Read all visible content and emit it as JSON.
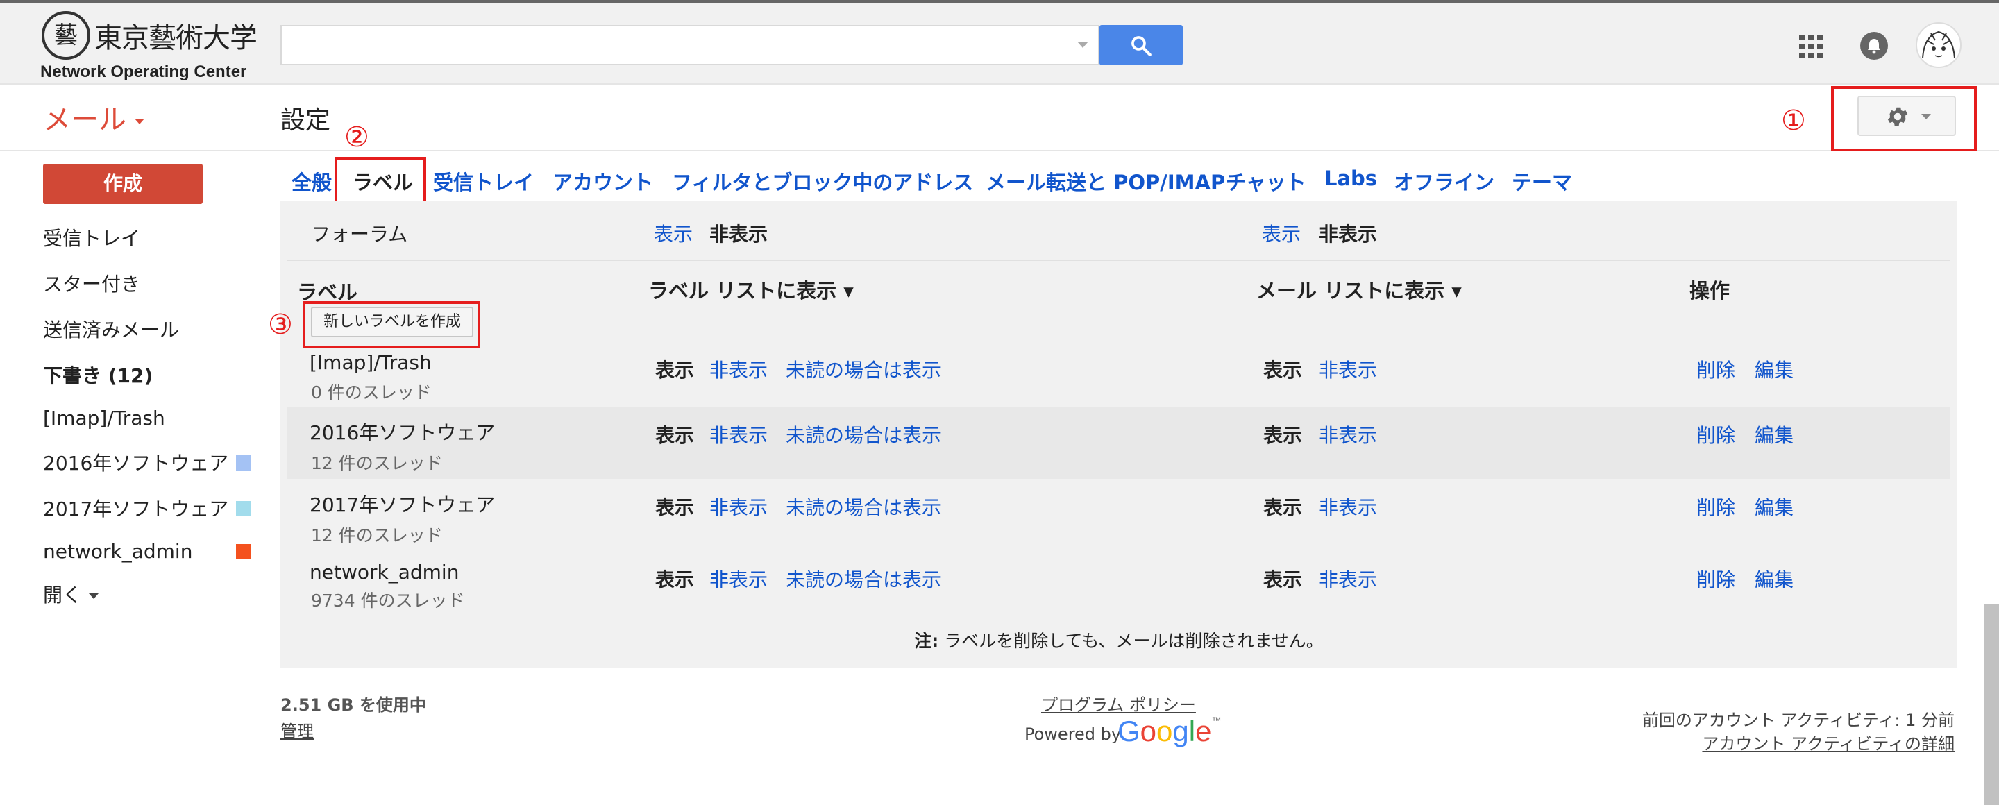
{
  "header": {
    "logo_jp": "東京藝術大学",
    "logo_en": "Network Operating Center",
    "search_value": ""
  },
  "subheader": {
    "mail_menu": "メール",
    "page_title": "設定"
  },
  "annotations": [
    "①",
    "②",
    "③"
  ],
  "sidebar": {
    "compose": "作成",
    "items": [
      {
        "label": "受信トレイ"
      },
      {
        "label": "スター付き"
      },
      {
        "label": "送信済みメール"
      },
      {
        "label": "下書き (12)"
      },
      {
        "label": "[Imap]/Trash"
      },
      {
        "label": "2016年ソフトウェア",
        "color": "#a4c2f4"
      },
      {
        "label": "2017年ソフトウェア",
        "color": "#a2dcec"
      },
      {
        "label": "network_admin",
        "color": "#f4511e"
      },
      {
        "label": "開く"
      }
    ]
  },
  "tabs": [
    "全般",
    "ラベル",
    "受信トレイ",
    "アカウント",
    "フィルタとブロック中のアドレス",
    "メール転送と POP/IMAP",
    "チャット",
    "Labs",
    "オフライン",
    "テーマ"
  ],
  "panel": {
    "forum": {
      "name": "フォーラム",
      "show": "表示",
      "hide": "非表示"
    },
    "columns": {
      "label": "ラベル",
      "label_list": "ラベル リストに表示 ▾",
      "mail_list": "メール リストに表示 ▾",
      "actions": "操作"
    },
    "create_label_button": "新しいラベルを作成",
    "show": "表示",
    "hide": "非表示",
    "show_if_unread": "未読の場合は表示",
    "delete": "削除",
    "edit": "編集",
    "labels": [
      {
        "name": "[Imap]/Trash",
        "threads": "0 件のスレッド"
      },
      {
        "name": "2016年ソフトウェア",
        "threads": "12 件のスレッド"
      },
      {
        "name": "2017年ソフトウェア",
        "threads": "12 件のスレッド"
      },
      {
        "name": "network_admin",
        "threads": "9734 件のスレッド"
      }
    ],
    "note_bold": "注:",
    "note": " ラベルを削除しても、メールは削除されません。"
  },
  "footer": {
    "storage": "2.51 GB を使用中",
    "manage": "管理",
    "policy": "プログラム ポリシー",
    "powered_by": "Powered by",
    "google_letters": [
      "G",
      "o",
      "o",
      "g",
      "l",
      "e"
    ],
    "google_colors": [
      "#4285f4",
      "#ea4335",
      "#fbbc05",
      "#4285f4",
      "#34a853",
      "#ea4335"
    ],
    "trademark": "™",
    "last_activity": "前回のアカウント アクティビティ: 1 分前",
    "activity_details": "アカウント アクティビティの詳細"
  },
  "colors": {
    "accent_red": "#dd4b39",
    "link_blue": "#1155cc",
    "annotation_red": "#e51d1d"
  }
}
